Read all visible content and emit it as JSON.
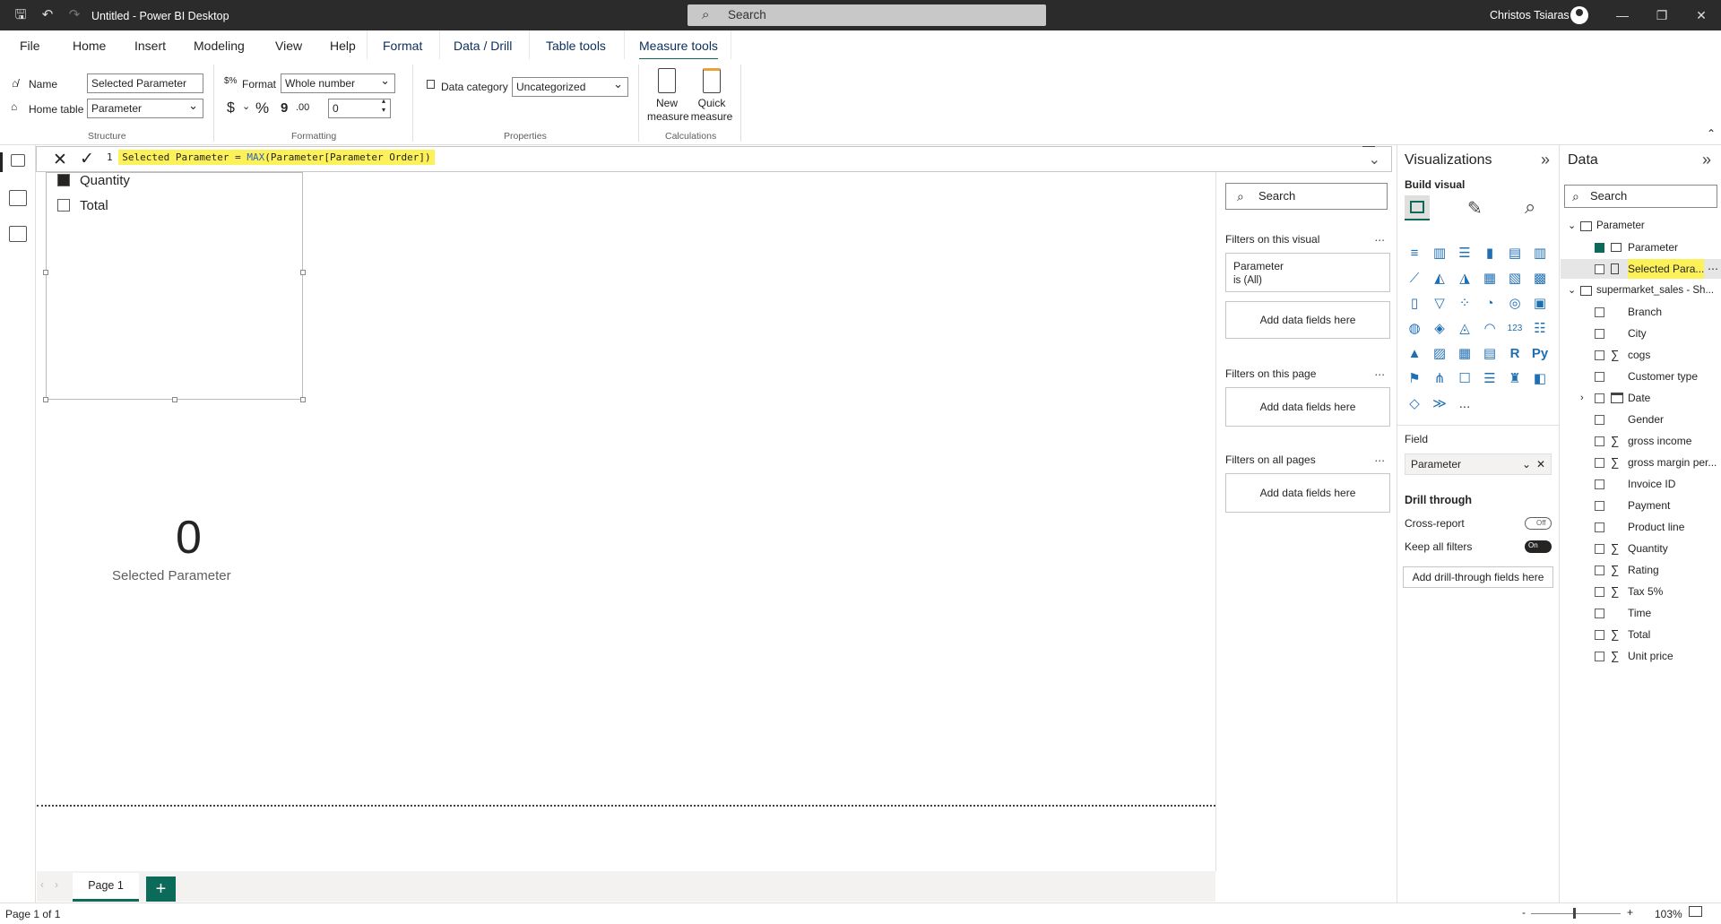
{
  "window": {
    "title": "Untitled - Power BI Desktop",
    "search_placeholder": "Search",
    "user": "Christos Tsiaras"
  },
  "menu": {
    "items": [
      "File",
      "Home",
      "Insert",
      "Modeling",
      "View",
      "Help",
      "Format",
      "Data / Drill",
      "Table tools",
      "Measure tools"
    ],
    "active": "Measure tools"
  },
  "ribbon": {
    "structure": {
      "name_label": "Name",
      "name_value": "Selected Parameter",
      "home_table_label": "Home table",
      "home_table_value": "Parameter",
      "group": "Structure"
    },
    "formatting": {
      "format_label": "Format",
      "format_value": "Whole number",
      "currency": "$",
      "percent": "%",
      "comma": "9",
      "decimal": ".00",
      "decimals_value": "0",
      "group": "Formatting"
    },
    "properties": {
      "data_category_label": "Data category",
      "data_category_value": "Uncategorized",
      "group": "Properties"
    },
    "calculations": {
      "new_measure_1": "New",
      "new_measure_2": "measure",
      "quick_measure_1": "Quick",
      "quick_measure_2": "measure",
      "group": "Calculations"
    }
  },
  "formula": {
    "line_no": "1",
    "lhs": "Selected Parameter = ",
    "fn": "MAX",
    "args": "(Parameter[Parameter Order])"
  },
  "slicer": {
    "items": [
      {
        "label": "Quantity",
        "checked": true
      },
      {
        "label": "Total",
        "checked": false
      }
    ]
  },
  "card": {
    "value": "0",
    "label": "Selected Parameter"
  },
  "pages": {
    "tab": "Page 1",
    "add": "+"
  },
  "status": {
    "page": "Page 1 of 1",
    "minus": "-",
    "plus": "+",
    "zoom": "103%"
  },
  "filters": {
    "search": "Search",
    "on_visual": "Filters on this visual",
    "visual_card_title": "Parameter",
    "visual_card_sub": "is (All)",
    "add_fields": "Add data fields here",
    "on_page": "Filters on this page",
    "on_all": "Filters on all pages",
    "dots": "..."
  },
  "visualizations": {
    "title": "Visualizations",
    "build_visual": "Build visual",
    "field_label": "Field",
    "field_value": "Parameter",
    "drill_through": "Drill through",
    "cross_report": "Cross-report",
    "cross_report_state": "Off",
    "keep_all_filters": "Keep all filters",
    "keep_all_filters_state": "On",
    "add_drill": "Add drill-through fields here",
    "more": "..."
  },
  "data": {
    "title": "Data",
    "search": "Search",
    "tables": [
      {
        "name": "Parameter",
        "fields": [
          {
            "label": "Parameter",
            "checked": true,
            "type": "table"
          },
          {
            "label": "Selected Para...",
            "checked": false,
            "type": "measure",
            "highlight": true
          }
        ]
      },
      {
        "name": "supermarket_sales - Sh...",
        "fields": [
          {
            "label": "Branch",
            "checked": false,
            "type": "text"
          },
          {
            "label": "City",
            "checked": false,
            "type": "text"
          },
          {
            "label": "cogs",
            "checked": false,
            "type": "sum"
          },
          {
            "label": "Customer type",
            "checked": false,
            "type": "text"
          },
          {
            "label": "Date",
            "checked": false,
            "type": "date"
          },
          {
            "label": "Gender",
            "checked": false,
            "type": "text"
          },
          {
            "label": "gross income",
            "checked": false,
            "type": "sum"
          },
          {
            "label": "gross margin per...",
            "checked": false,
            "type": "sum"
          },
          {
            "label": "Invoice ID",
            "checked": false,
            "type": "text"
          },
          {
            "label": "Payment",
            "checked": false,
            "type": "text"
          },
          {
            "label": "Product line",
            "checked": false,
            "type": "text"
          },
          {
            "label": "Quantity",
            "checked": false,
            "type": "sum"
          },
          {
            "label": "Rating",
            "checked": false,
            "type": "sum"
          },
          {
            "label": "Tax 5%",
            "checked": false,
            "type": "sum"
          },
          {
            "label": "Time",
            "checked": false,
            "type": "text"
          },
          {
            "label": "Total",
            "checked": false,
            "type": "sum"
          },
          {
            "label": "Unit price",
            "checked": false,
            "type": "sum"
          }
        ]
      }
    ]
  }
}
